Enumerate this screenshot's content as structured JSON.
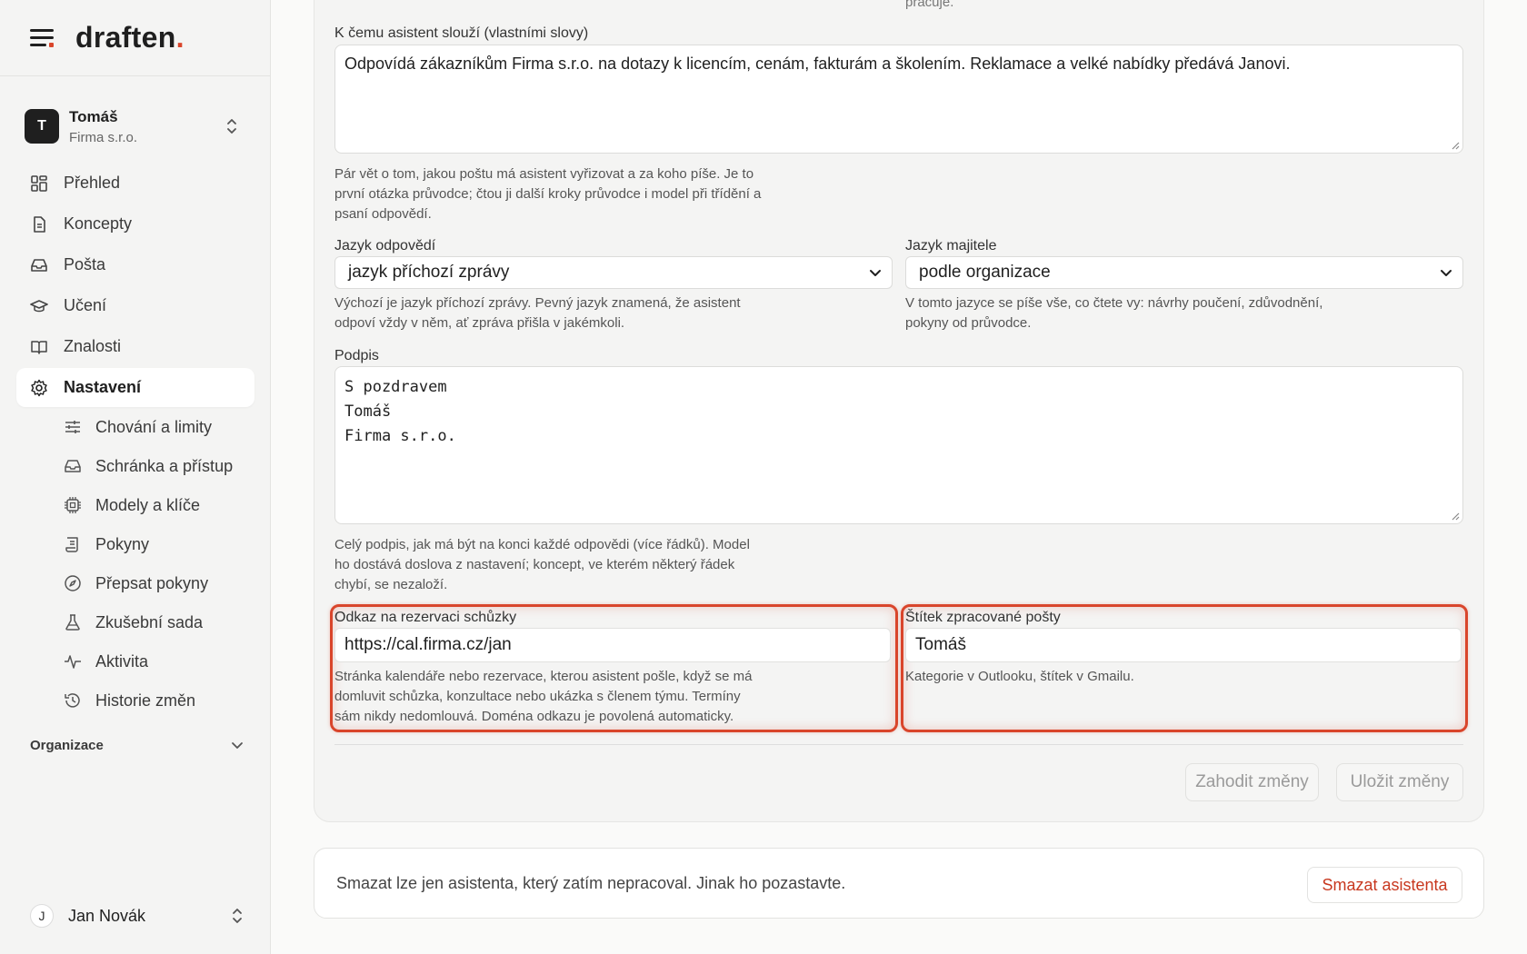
{
  "brand": {
    "name": "draften",
    "dot": "."
  },
  "account": {
    "initial": "T",
    "name": "Tomáš",
    "org": "Firma s.r.o."
  },
  "nav": [
    {
      "label": "Přehled",
      "icon": "dashboard-icon"
    },
    {
      "label": "Koncepty",
      "icon": "document-icon"
    },
    {
      "label": "Pošta",
      "icon": "inbox-icon"
    },
    {
      "label": "Učení",
      "icon": "graduation-cap-icon"
    },
    {
      "label": "Znalosti",
      "icon": "book-icon"
    },
    {
      "label": "Nastavení",
      "icon": "gear-icon",
      "active": true
    }
  ],
  "subnav": [
    {
      "label": "Chování a limity",
      "icon": "sliders-icon"
    },
    {
      "label": "Schránka a přístup",
      "icon": "inbox-icon"
    },
    {
      "label": "Modely a klíče",
      "icon": "chip-icon"
    },
    {
      "label": "Pokyny",
      "icon": "scroll-icon"
    },
    {
      "label": "Přepsat pokyny",
      "icon": "compass-icon"
    },
    {
      "label": "Zkušební sada",
      "icon": "flask-icon"
    },
    {
      "label": "Aktivita",
      "icon": "activity-icon"
    },
    {
      "label": "Historie změn",
      "icon": "history-icon"
    }
  ],
  "org_section": "Organizace",
  "user": {
    "initial": "J",
    "name": "Jan Novák"
  },
  "form": {
    "top_snippet": "pracuje.",
    "purpose": {
      "label": "K čemu asistent slouží (vlastními slovy)",
      "value": "Odpovídá zákazníkům Firma s.r.o. na dotazy k licencím, cenám, fakturám a školením. Reklamace a velké nabídky předává Janovi.",
      "help1": "Pár vět o tom, jakou poštu má asistent vyřizovat a za koho píše. Je to",
      "help2": "první otázka průvodce; čtou ji další kroky průvodce i model při třídění a",
      "help3": "psaní odpovědí."
    },
    "reply_language": {
      "label": "Jazyk odpovědí",
      "value": "jazyk příchozí zprávy",
      "help1": "Výchozí je jazyk příchozí zprávy. Pevný jazyk znamená, že asistent",
      "help2": "odpoví vždy v něm, ať zpráva přišla v jakémkoli."
    },
    "owner_language": {
      "label": "Jazyk majitele",
      "value": "podle organizace",
      "help1": "V tomto jazyce se píše vše, co čtete vy: návrhy poučení, zdůvodnění,",
      "help2": "pokyny od průvodce."
    },
    "signature": {
      "label": "Podpis",
      "value": "S pozdravem\nTomáš\nFirma s.r.o.",
      "help1": "Celý podpis, jak má být na konci každé odpovědi (více řádků). Model",
      "help2": "ho dostává doslova z nastavení; koncept, ve kterém některý řádek",
      "help3": "chybí, se nezaloží."
    },
    "booking_link": {
      "label": "Odkaz na rezervaci schůzky",
      "value": "https://cal.firma.cz/jan",
      "help1": "Stránka kalendáře nebo rezervace, kterou asistent pošle, když se má",
      "help2": "domluvit schůzka, konzultace nebo ukázka s členem týmu. Termíny",
      "help3": "sám nikdy nedomlouvá. Doména odkazu je povolená automaticky."
    },
    "processed_tag": {
      "label": "Štítek zpracované pošty",
      "value": "Tomáš",
      "help1": "Kategorie v Outlooku, štítek v Gmailu."
    },
    "discard_label": "Zahodit změny",
    "save_label": "Uložit změny"
  },
  "delete": {
    "text": "Smazat lze jen asistenta, který zatím nepracoval. Jinak ho pozastavte.",
    "button": "Smazat asistenta"
  },
  "colors": {
    "accent": "#d9452b",
    "danger_text": "#c8381f"
  }
}
